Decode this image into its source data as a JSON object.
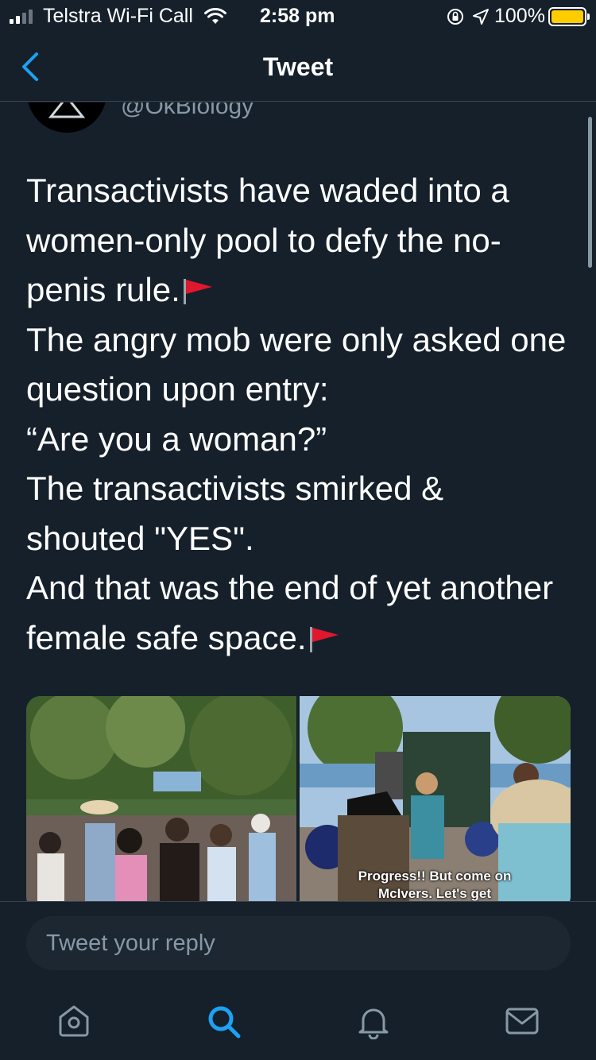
{
  "status_bar": {
    "carrier": "Telstra Wi-Fi Call",
    "time": "2:58 pm",
    "battery": "100%",
    "battery_level": 1.0
  },
  "nav": {
    "title": "Tweet",
    "back_icon": "chevron-left-icon"
  },
  "tweet": {
    "handle": "@OkBiology",
    "text_lines": [
      "Transactivists have waded into a",
      "women-only pool to defy the no-",
      "penis rule.",
      "The angry mob were only asked one",
      "question upon entry:",
      "“Are you a woman?”",
      "The transactivists smirked &",
      "shouted \"YES\".",
      "And that was the end of yet another",
      "female safe space."
    ],
    "emoji": "red-flag-icon",
    "media_caption_line1": "Progress!! But come on",
    "media_caption_line2": "McIvers. Let's get"
  },
  "reply": {
    "placeholder": "Tweet your reply"
  },
  "tabs": [
    {
      "name": "home-icon"
    },
    {
      "name": "search-icon",
      "active": true
    },
    {
      "name": "notifications-bell-icon"
    },
    {
      "name": "messages-envelope-icon"
    }
  ],
  "colors": {
    "background": "#15202b",
    "accent": "#1da1f2",
    "secondary_text": "#8899a6",
    "battery": "#ffcc00",
    "divider": "#38444d"
  }
}
